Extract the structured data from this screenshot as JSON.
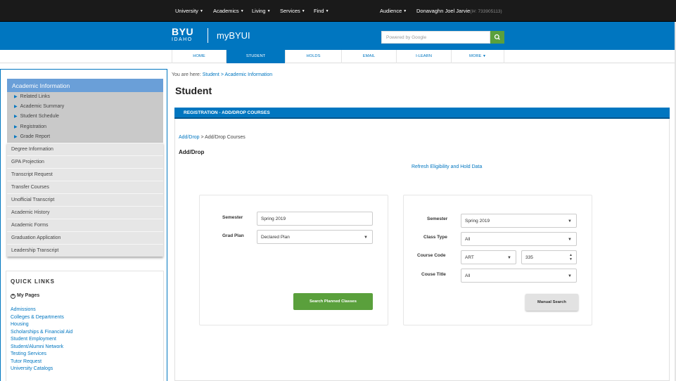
{
  "topbar": {
    "nav": [
      "University",
      "Academics",
      "Living",
      "Services",
      "Find"
    ],
    "audience": "Audience",
    "user_name": "Donavaghn Joel Jarvie",
    "user_id": "(I#: 733905113)"
  },
  "header": {
    "logo_byu": "BYU",
    "logo_idaho": "IDAHO",
    "site_name": "myBYUI",
    "search_placeholder": "Powered by Google"
  },
  "tabs": [
    "HOME",
    "STUDENT",
    "HOLDS",
    "EMAIL",
    "I-LEARN",
    "MORE"
  ],
  "breadcrumb": {
    "prefix": "You are here:",
    "student": "Student",
    "sep": ">",
    "current": "Academic Information"
  },
  "page_title": "Student",
  "sidebar": {
    "section": "Academic Information",
    "sub_items": [
      "Related Links",
      "Academic Summary",
      "Student Schedule",
      "Registration",
      "Grade Report"
    ],
    "items": [
      "Degree Information",
      "GPA Projection",
      "Transcript Request",
      "Transfer Courses",
      "Unofficial Transcript",
      "Academic History",
      "Academic Forms",
      "Graduation Application",
      "Leadership Transcript"
    ]
  },
  "quick_links": {
    "title": "QUICK LINKS",
    "my_pages": "My Pages",
    "links": [
      "Admissions",
      "Colleges & Departments",
      "Housing",
      "Scholarships & Financial Aid",
      "Student Employment",
      "Student/Alumni Network",
      "Testing Services",
      "Tutor Request",
      "University Catalogs"
    ]
  },
  "panel": {
    "title": "REGISTRATION - ADD/DROP COURSES",
    "crumb_link": "Add/Drop",
    "crumb_rest": "> Add/Drop Courses",
    "heading": "Add/Drop",
    "refresh": "Refresh Eligibility and Hold Data"
  },
  "planned": {
    "semester_label": "Semester",
    "semester_value": "Spring 2019",
    "grad_plan_label": "Grad Plan",
    "grad_plan_value": "Declared Plan",
    "button": "Search Planned Classes"
  },
  "manual": {
    "semester_label": "Semester",
    "semester_value": "Spring 2019",
    "class_type_label": "Class Type",
    "class_type_value": "All",
    "course_code_label": "Course Code",
    "subject_value": "ART",
    "number_value": "335",
    "course_title_label": "Couse Title",
    "course_title_value": "All",
    "button": "Manual Search"
  },
  "colors": {
    "brand_blue": "#0076c0",
    "topbar": "#1a1a1a",
    "green": "#5aa03c"
  }
}
